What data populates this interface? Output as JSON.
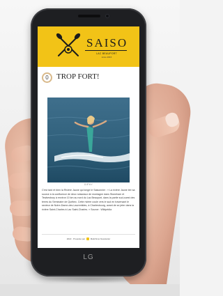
{
  "header": {
    "brand": "SAISO",
    "subtitle": "LAC BEAUPORT",
    "subtitle2": "since 2016",
    "brand_color": "#f2c317"
  },
  "post": {
    "counter": "0",
    "title": "TROP FORT!",
    "image_icon": "surfer-photo",
    "image_credit": "GIPHY",
    "body": "C'est tard et bien la Rivière Jaune qui longe le Saisonnier : « La rivière Jaune tire sa source à la confluence de deux ruisseaux de montagne dans Stoneham et Tewkesbury à environ 10 km au nord du Lac Beauport, dans la partie sud-ouest des terres du Séminaire de Québec. Cette rivière coule vers le sud en traversant le secteur de Notre-Dame-des-Laurentides, à Charlesbourg, avant de se jeter dans la rivière Saint-Charles à Lac Saint-Charles. » Source : Wikipédia"
  },
  "footer": {
    "text": "2022 · Propulsé par",
    "powered_by": "Mailchimp Newsletter"
  },
  "device": {
    "brand": "LG"
  }
}
